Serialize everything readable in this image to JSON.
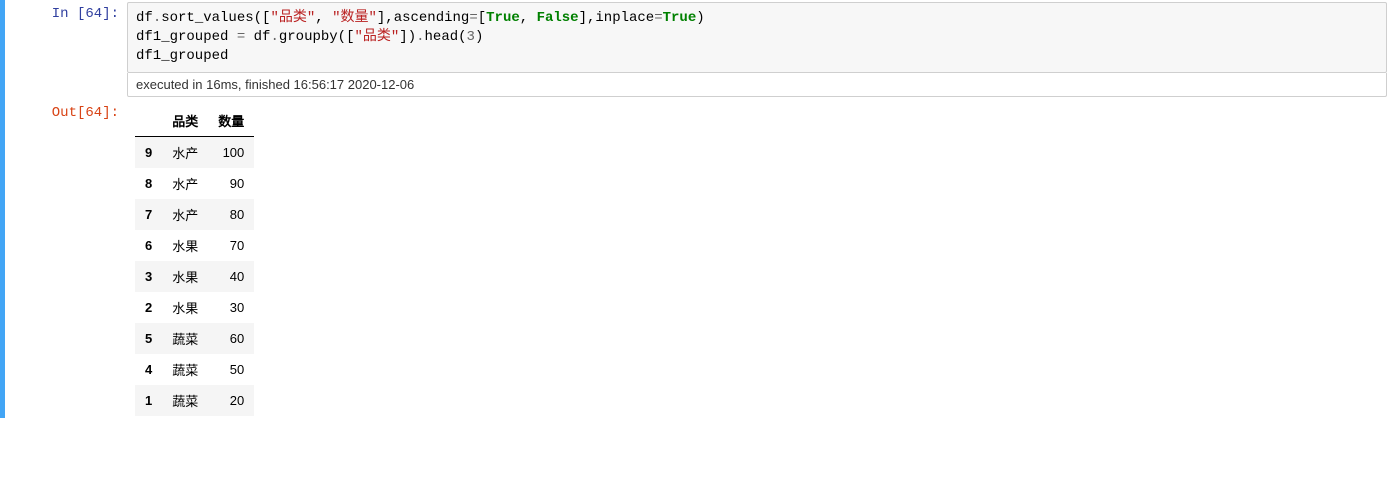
{
  "cell": {
    "in_prompt": "In  [64]:",
    "out_prompt": "Out[64]:",
    "exec_status": "executed in 16ms, finished 16:56:17 2020-12-06",
    "code": {
      "line1": {
        "t1": "df",
        "dot1": ".",
        "sort": "sort_values",
        "lp1": "(",
        "lb1": "[",
        "s1": "\"品类\"",
        "comma1": ", ",
        "s2": "\"数量\"",
        "rb1": "]",
        "comma2": ",",
        "asc": "ascending",
        "eq1": "=",
        "lb2": "[",
        "true": "True",
        "comma3": ", ",
        "false": "False",
        "rb2": "]",
        "comma4": ",",
        "inplace": "inplace",
        "eq2": "=",
        "true2": "True",
        "rp1": ")"
      },
      "line2": {
        "dfg": "df1_grouped ",
        "eq": "=",
        "sp": " df",
        "dot": ".",
        "gb": "groupby",
        "lp": "(",
        "lb": "[",
        "s": "\"品类\"",
        "rb": "]",
        "rp": ")",
        "dot2": ".",
        "head": "head",
        "lp2": "(",
        "n": "3",
        "rp2": ")"
      },
      "line3": "df1_grouped"
    }
  },
  "dataframe": {
    "columns": [
      "品类",
      "数量"
    ],
    "index": [
      "9",
      "8",
      "7",
      "6",
      "3",
      "2",
      "5",
      "4",
      "1"
    ],
    "rows": [
      [
        "水产",
        "100"
      ],
      [
        "水产",
        "90"
      ],
      [
        "水产",
        "80"
      ],
      [
        "水果",
        "70"
      ],
      [
        "水果",
        "40"
      ],
      [
        "水果",
        "30"
      ],
      [
        "蔬菜",
        "60"
      ],
      [
        "蔬菜",
        "50"
      ],
      [
        "蔬菜",
        "20"
      ]
    ]
  }
}
